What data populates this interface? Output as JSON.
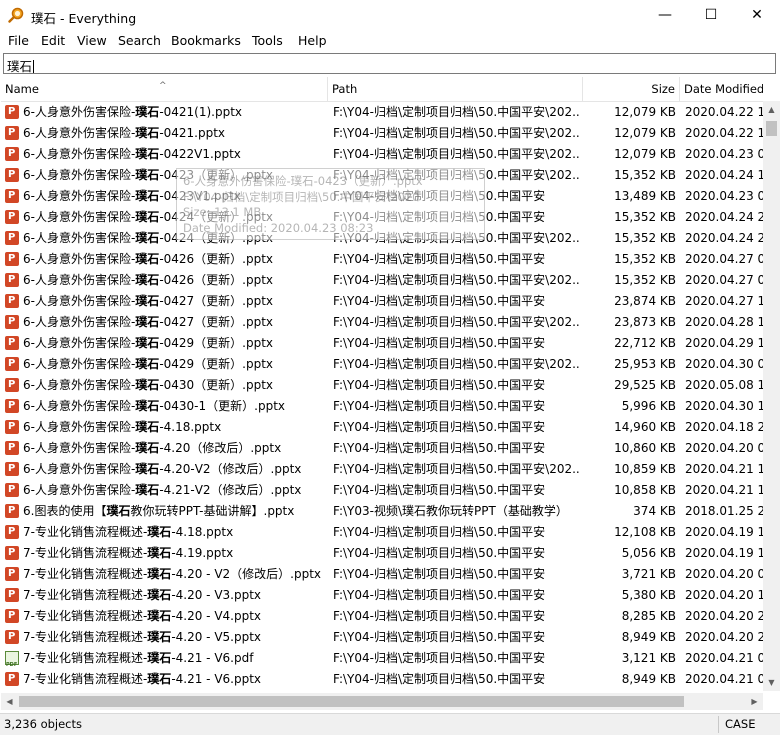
{
  "window": {
    "title": "璞石 - Everything",
    "app_icon": "magnifier-icon"
  },
  "controls": {
    "minimize": "—",
    "maximize": "☐",
    "close": "✕"
  },
  "menu": [
    "File",
    "Edit",
    "View",
    "Search",
    "Bookmarks",
    "Tools",
    "Help"
  ],
  "search": {
    "value": "璞石"
  },
  "columns": {
    "name": "Name",
    "path": "Path",
    "size": "Size",
    "date": "Date Modified"
  },
  "rows": [
    {
      "icon": "ppt",
      "pre": "6-人身意外伤害保险-",
      "bold": "璞石",
      "post": "-0421(1).pptx",
      "path": "F:\\Y04-归档\\定制项目归档\\50.中国平安\\202...",
      "size": "12,079 KB",
      "date": "2020.04.22 17:"
    },
    {
      "icon": "ppt",
      "pre": "6-人身意外伤害保险-",
      "bold": "璞石",
      "post": "-0421.pptx",
      "path": "F:\\Y04-归档\\定制项目归档\\50.中国平安\\202...",
      "size": "12,079 KB",
      "date": "2020.04.22 17:"
    },
    {
      "icon": "ppt",
      "pre": "6-人身意外伤害保险-",
      "bold": "璞石",
      "post": "-0422V1.pptx",
      "path": "F:\\Y04-归档\\定制项目归档\\50.中国平安\\202...",
      "size": "12,079 KB",
      "date": "2020.04.23 08:"
    },
    {
      "icon": "ppt",
      "pre": "6-人身意外伤害保险-",
      "bold": "璞石",
      "post": "-0423（更新）.pptx",
      "path": "F:\\Y04-归档\\定制项目归档\\50.中国平安\\202...",
      "size": "15,352 KB",
      "date": "2020.04.24 10:"
    },
    {
      "icon": "ppt",
      "pre": "6-人身意外伤害保险-",
      "bold": "璞石",
      "post": "-0423V1.pptx",
      "path": "F:\\Y04-归档\\定制项目归档\\50.中国平安",
      "size": "13,489 KB",
      "date": "2020.04.23 08:"
    },
    {
      "icon": "ppt",
      "pre": "6-人身意外伤害保险-",
      "bold": "璞石",
      "post": "-0424（更新）.pptx",
      "path": "F:\\Y04-归档\\定制项目归档\\50.中国平安",
      "size": "15,352 KB",
      "date": "2020.04.24 22:"
    },
    {
      "icon": "ppt",
      "pre": "6-人身意外伤害保险-",
      "bold": "璞石",
      "post": "-0424（更新）.pptx",
      "path": "F:\\Y04-归档\\定制项目归档\\50.中国平安\\202...",
      "size": "15,352 KB",
      "date": "2020.04.24 22:"
    },
    {
      "icon": "ppt",
      "pre": "6-人身意外伤害保险-",
      "bold": "璞石",
      "post": "-0426（更新）.pptx",
      "path": "F:\\Y04-归档\\定制项目归档\\50.中国平安",
      "size": "15,352 KB",
      "date": "2020.04.27 09:"
    },
    {
      "icon": "ppt",
      "pre": "6-人身意外伤害保险-",
      "bold": "璞石",
      "post": "-0426（更新）.pptx",
      "path": "F:\\Y04-归档\\定制项目归档\\50.中国平安\\202...",
      "size": "15,352 KB",
      "date": "2020.04.27 09:"
    },
    {
      "icon": "ppt",
      "pre": "6-人身意外伤害保险-",
      "bold": "璞石",
      "post": "-0427（更新）.pptx",
      "path": "F:\\Y04-归档\\定制项目归档\\50.中国平安",
      "size": "23,874 KB",
      "date": "2020.04.27 18:"
    },
    {
      "icon": "ppt",
      "pre": "6-人身意外伤害保险-",
      "bold": "璞石",
      "post": "-0427（更新）.pptx",
      "path": "F:\\Y04-归档\\定制项目归档\\50.中国平安\\202...",
      "size": "23,873 KB",
      "date": "2020.04.28 18:"
    },
    {
      "icon": "ppt",
      "pre": "6-人身意外伤害保险-",
      "bold": "璞石",
      "post": "-0429（更新）.pptx",
      "path": "F:\\Y04-归档\\定制项目归档\\50.中国平安",
      "size": "22,712 KB",
      "date": "2020.04.29 12:"
    },
    {
      "icon": "ppt",
      "pre": "6-人身意外伤害保险-",
      "bold": "璞石",
      "post": "-0429（更新）.pptx",
      "path": "F:\\Y04-归档\\定制项目归档\\50.中国平安\\202...",
      "size": "25,953 KB",
      "date": "2020.04.30 06:"
    },
    {
      "icon": "ppt",
      "pre": "6-人身意外伤害保险-",
      "bold": "璞石",
      "post": "-0430（更新）.pptx",
      "path": "F:\\Y04-归档\\定制项目归档\\50.中国平安",
      "size": "29,525 KB",
      "date": "2020.05.08 10:"
    },
    {
      "icon": "ppt",
      "pre": "6-人身意外伤害保险-",
      "bold": "璞石",
      "post": "-0430-1（更新）.pptx",
      "path": "F:\\Y04-归档\\定制项目归档\\50.中国平安",
      "size": "5,996 KB",
      "date": "2020.04.30 10:"
    },
    {
      "icon": "ppt",
      "pre": "6-人身意外伤害保险-",
      "bold": "璞石",
      "post": "-4.18.pptx",
      "path": "F:\\Y04-归档\\定制项目归档\\50.中国平安",
      "size": "14,960 KB",
      "date": "2020.04.18 22:"
    },
    {
      "icon": "ppt",
      "pre": "6-人身意外伤害保险-",
      "bold": "璞石",
      "post": "-4.20（修改后）.pptx",
      "path": "F:\\Y04-归档\\定制项目归档\\50.中国平安",
      "size": "10,860 KB",
      "date": "2020.04.20 08:"
    },
    {
      "icon": "ppt",
      "pre": "6-人身意外伤害保险-",
      "bold": "璞石",
      "post": "-4.20-V2（修改后）.pptx",
      "path": "F:\\Y04-归档\\定制项目归档\\50.中国平安\\202...",
      "size": "10,859 KB",
      "date": "2020.04.21 10:"
    },
    {
      "icon": "ppt",
      "pre": "6-人身意外伤害保险-",
      "bold": "璞石",
      "post": "-4.21-V2（修改后）.pptx",
      "path": "F:\\Y04-归档\\定制项目归档\\50.中国平安",
      "size": "10,858 KB",
      "date": "2020.04.21 15:"
    },
    {
      "icon": "ppt",
      "pre": "6.图表的使用【",
      "bold": "璞石",
      "post": "教你玩转PPT-基础讲解】.pptx",
      "path": "F:\\Y03-视频\\璞石教你玩转PPT（基础教学）",
      "size": "374 KB",
      "date": "2018.01.25 21:"
    },
    {
      "icon": "ppt",
      "pre": "7-专业化销售流程概述-",
      "bold": "璞石",
      "post": "-4.18.pptx",
      "path": "F:\\Y04-归档\\定制项目归档\\50.中国平安",
      "size": "12,108 KB",
      "date": "2020.04.19 15:"
    },
    {
      "icon": "ppt",
      "pre": "7-专业化销售流程概述-",
      "bold": "璞石",
      "post": "-4.19.pptx",
      "path": "F:\\Y04-归档\\定制项目归档\\50.中国平安",
      "size": "5,056 KB",
      "date": "2020.04.19 15:"
    },
    {
      "icon": "ppt",
      "pre": "7-专业化销售流程概述-",
      "bold": "璞石",
      "post": "-4.20 - V2（修改后）.pptx",
      "path": "F:\\Y04-归档\\定制项目归档\\50.中国平安",
      "size": "3,721 KB",
      "date": "2020.04.20 08:"
    },
    {
      "icon": "ppt",
      "pre": "7-专业化销售流程概述-",
      "bold": "璞石",
      "post": "-4.20 - V3.pptx",
      "path": "F:\\Y04-归档\\定制项目归档\\50.中国平安",
      "size": "5,380 KB",
      "date": "2020.04.20 13:"
    },
    {
      "icon": "ppt",
      "pre": "7-专业化销售流程概述-",
      "bold": "璞石",
      "post": "-4.20 - V4.pptx",
      "path": "F:\\Y04-归档\\定制项目归档\\50.中国平安",
      "size": "8,285 KB",
      "date": "2020.04.20 20:"
    },
    {
      "icon": "ppt",
      "pre": "7-专业化销售流程概述-",
      "bold": "璞石",
      "post": "-4.20 - V5.pptx",
      "path": "F:\\Y04-归档\\定制项目归档\\50.中国平安",
      "size": "8,949 KB",
      "date": "2020.04.20 22:"
    },
    {
      "icon": "pdf",
      "pre": "7-专业化销售流程概述-",
      "bold": "璞石",
      "post": "-4.21 - V6.pdf",
      "path": "F:\\Y04-归档\\定制项目归档\\50.中国平安",
      "size": "3,121 KB",
      "date": "2020.04.21 08:"
    },
    {
      "icon": "ppt",
      "pre": "7-专业化销售流程概述-",
      "bold": "璞石",
      "post": "-4.21 - V6.pptx",
      "path": "F:\\Y04-归档\\定制项目归档\\50.中国平安",
      "size": "8,949 KB",
      "date": "2020.04.21 08:"
    }
  ],
  "tooltip": {
    "line1": "6-人身意外伤害保险-璞石-0423（更新）.pptx",
    "line2": "F:\\Y04-归档\\定制项目归档\\50.中国平安\\2020",
    "line3": "Size: 13.1 MB",
    "line4": "Date Modified: 2020.04.23 08:23"
  },
  "status": {
    "count": "3,236 objects",
    "mode": "CASE"
  }
}
